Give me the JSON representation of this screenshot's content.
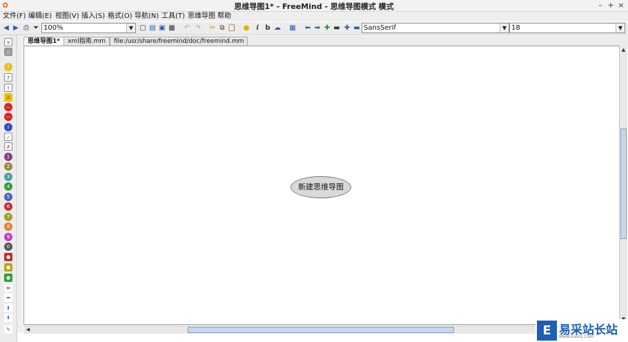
{
  "window": {
    "title": "思维导图1* - FreeMind - 思维导图模式 模式",
    "minimize": "–",
    "maximize": "+",
    "close": "×"
  },
  "menu": [
    "文件(F)",
    "编辑(E)",
    "视图(V)",
    "插入(S)",
    "格式(O)",
    "导航(N)",
    "工具(T)",
    "思维导图",
    "帮助"
  ],
  "toolbar": {
    "zoom": "100%",
    "font_family": "SansSerif",
    "font_size": "18",
    "bold_label": "b",
    "italic_label": "i"
  },
  "tabs": [
    {
      "label": "思维导图1*",
      "active": true
    },
    {
      "label": "xml指南.mm",
      "active": false
    },
    {
      "label": "file:/usr/share/freemind/doc/freemind.mm",
      "active": false
    }
  ],
  "map": {
    "root_node": "新建思维导图"
  },
  "watermark": {
    "logo_text": "E",
    "name": "易采站长站",
    "sub": "Www.Easck.Com"
  },
  "colors": {
    "accent": "#2a5db0",
    "node_fill": "#d9d9d9"
  }
}
